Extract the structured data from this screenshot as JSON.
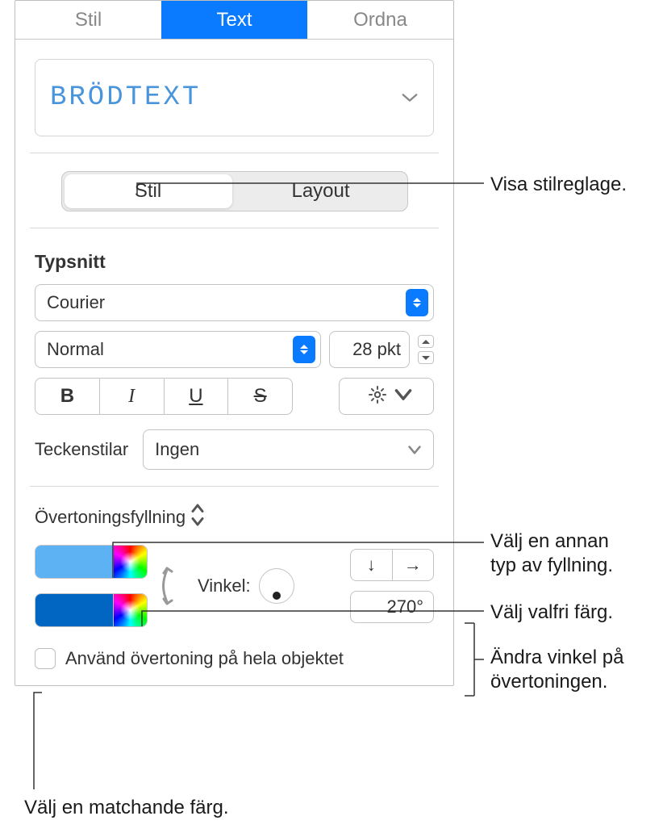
{
  "top_tabs": {
    "stil": "Stil",
    "text": "Text",
    "ordna": "Ordna"
  },
  "style_name": "BRÖDTEXT",
  "seg": {
    "stil": "Stil",
    "layout": "Layout"
  },
  "sections": {
    "typsnitt": "Typsnitt",
    "teckenstilar": "Teckenstilar"
  },
  "font": {
    "family": "Courier",
    "weight": "Normal",
    "size": "28 pkt"
  },
  "charstyle": "Ingen",
  "fill": {
    "type_label": "Övertoningsfyllning",
    "angle_label": "Vinkel:",
    "angle_value": "270°",
    "checkbox_label": "Använd övertoning på hela objektet"
  },
  "callouts": {
    "show_style": "Visa stilreglage.",
    "fill_type": "Välj en annan\ntyp av fyllning.",
    "any_color": "Välj valfri färg.",
    "angle": "Ändra vinkel på\növertoningen.",
    "matching": "Välj en matchande färg."
  }
}
